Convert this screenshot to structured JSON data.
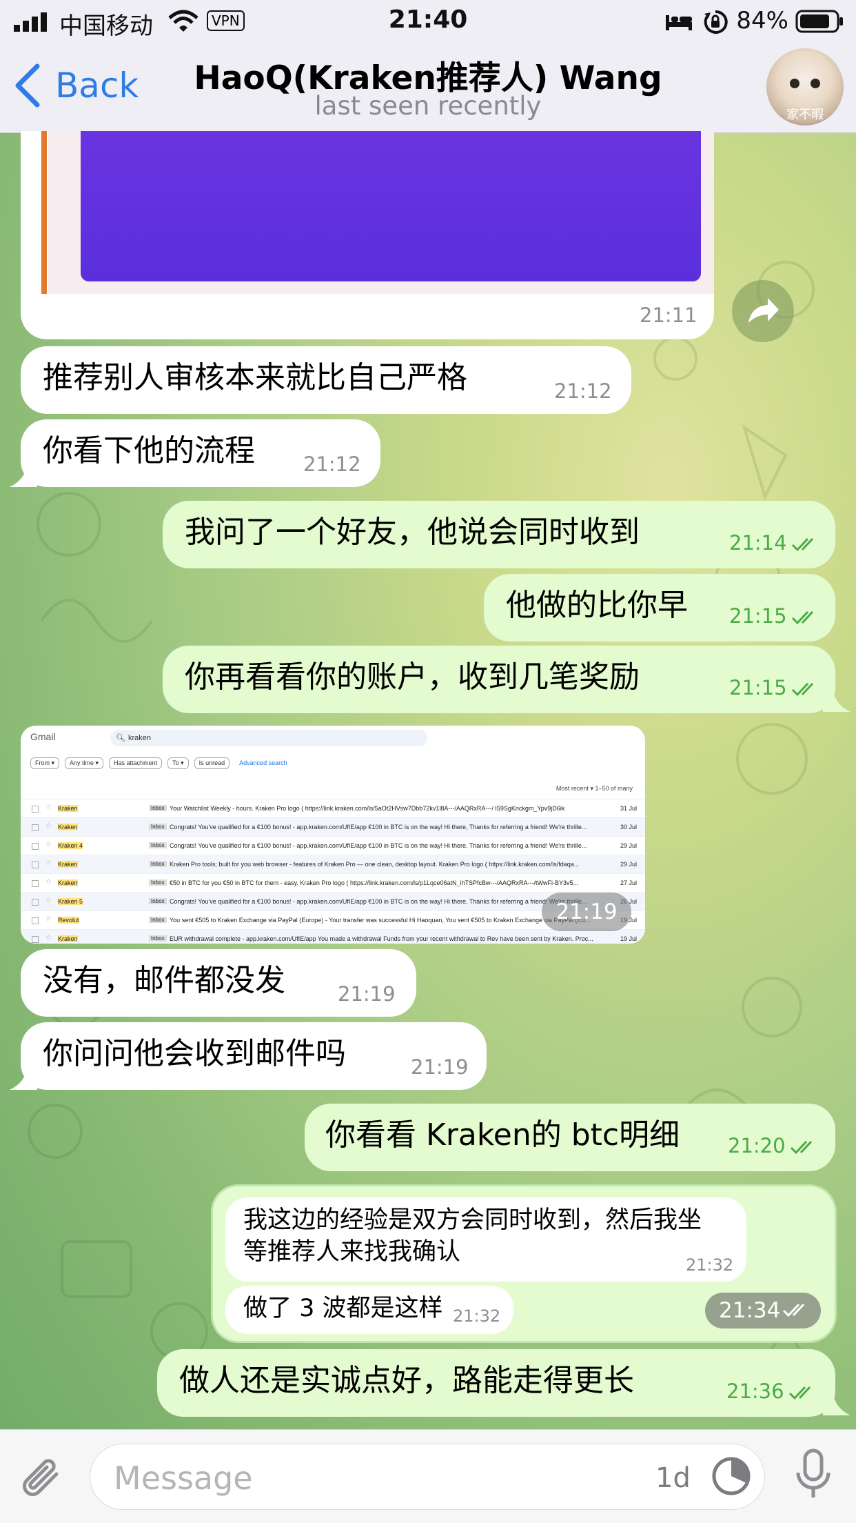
{
  "status": {
    "carrier": "中国移动",
    "vpn": "VPN",
    "time": "21:40",
    "battery": "84%"
  },
  "header": {
    "back_label": "Back",
    "title": "HaoQ(Kraken推荐人) Wang",
    "subtitle": "last seen recently",
    "avatar_caption": "家不暇"
  },
  "messages": [
    {
      "text": "",
      "time": "21:11"
    },
    {
      "text": "推荐别人审核本来就比自己严格",
      "time": "21:12"
    },
    {
      "text": "你看下他的流程",
      "time": "21:12"
    },
    {
      "text": "我问了一个好友，他说会同时收到",
      "time": "21:14"
    },
    {
      "text": "他做的比你早",
      "time": "21:15"
    },
    {
      "text": "你再看看你的账户，收到几笔奖励",
      "time": "21:15"
    },
    {
      "text": "",
      "time": "21:19"
    },
    {
      "text": "没有，邮件都没发",
      "time": "21:19"
    },
    {
      "text": "你问问他会收到邮件吗",
      "time": "21:19"
    },
    {
      "text": "你看看 Kraken的 btc明细",
      "time": "21:20"
    },
    {
      "text": "",
      "time": "21:34"
    },
    {
      "text": "做人还是实诚点好，路能走得更长",
      "time": "21:36"
    }
  ],
  "forwarded": [
    {
      "line1": "我这边的经验是双方会同时收到，然后我坐",
      "line2": "等推荐人来找我确认",
      "time": "21:32"
    },
    {
      "line1": "做了 3 波都是这样",
      "time": "21:32"
    }
  ],
  "gmail": {
    "app": "Gmail",
    "query": "kraken",
    "chips": [
      "From ▾",
      "Any time ▾",
      "Has attachment",
      "To ▾",
      "Is unread"
    ],
    "advanced": "Advanced search",
    "sort": "Most recent ▾   1–50 of many",
    "rows": [
      {
        "sender": "Kraken",
        "subject": "Your Watchlist Weekly - hours. Kraken Pro logo ( https://link.kraken.com/ls/5aOt2HVsw7Dbb72kv1l8A---/AAQRxRA---/ I59SgKnckgm_Ypv9jD6ik",
        "date": "31 Jul"
      },
      {
        "sender": "Kraken",
        "subject": "Congrats! You've qualified for a €100 bonus! - app.kraken.com/UfIE/app €100 in BTC is on the way! Hi there,  Thanks for referring a friend! We're thrille...",
        "date": "30 Jul"
      },
      {
        "sender": "Kraken 4",
        "subject": "Congrats! You've qualified for a €100 bonus! - app.kraken.com/UfIE/app €100 in BTC is on the way! Hi there,  Thanks for referring a friend! We're thrille...",
        "date": "29 Jul"
      },
      {
        "sender": "Kraken",
        "subject": "Kraken Pro tools; built for you web browser - features of Kraken Pro — one clean, desktop layout. Kraken Pro logo ( https://link.kraken.com/ls/fdaqa...",
        "date": "29 Jul"
      },
      {
        "sender": "Kraken",
        "subject": "€50 in BTC for you  €50 in BTC for them - easy. Kraken Pro logo ( https://link.kraken.com/ls/p1Lqce06atN_ihTSPfcBw---/AAQRxRA---/tWwFi-BY3v5...",
        "date": "27 Jul"
      },
      {
        "sender": "Kraken 5",
        "subject": "Congrats! You've qualified for a €100 bonus! - app.kraken.com/UfIE/app €100 in BTC is on the way! Hi there,  Thanks for referring a friend! We're thrille...",
        "date": "26 Jul"
      },
      {
        "sender": "Revolut",
        "subject": "You sent €505 to Kraken Exchange via PayPal (Europe) - Your transfer was successful Hi Haoquan, You sent €505 to Kraken Exchange via PayPal (Eu...",
        "date": "19 Jul"
      },
      {
        "sender": "Kraken",
        "subject": "EUR withdrawal complete - app.kraken.com/UfIE/app You made a withdrawal Funds from your recent withdrawal to Rev have been sent by Kraken. Proc...",
        "date": "19 Jul"
      }
    ]
  },
  "input": {
    "placeholder": "Message",
    "timer_label": "1d"
  }
}
